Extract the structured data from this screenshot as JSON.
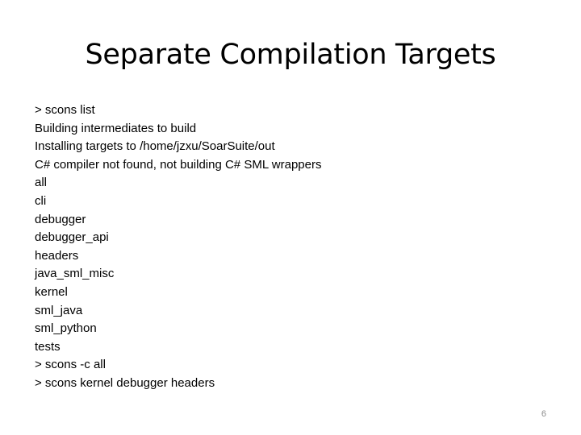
{
  "slide": {
    "title": "Separate Compilation Targets",
    "lines": [
      "> scons list",
      "Building intermediates to build",
      "Installing targets to /home/jzxu/SoarSuite/out",
      "C# compiler not found, not building C# SML wrappers",
      "all",
      "cli",
      "debugger",
      "debugger_api",
      "headers",
      "java_sml_misc",
      "kernel",
      "sml_java",
      "sml_python",
      "tests",
      "> scons -c all",
      "> scons kernel debugger headers"
    ],
    "page_number": "6"
  }
}
